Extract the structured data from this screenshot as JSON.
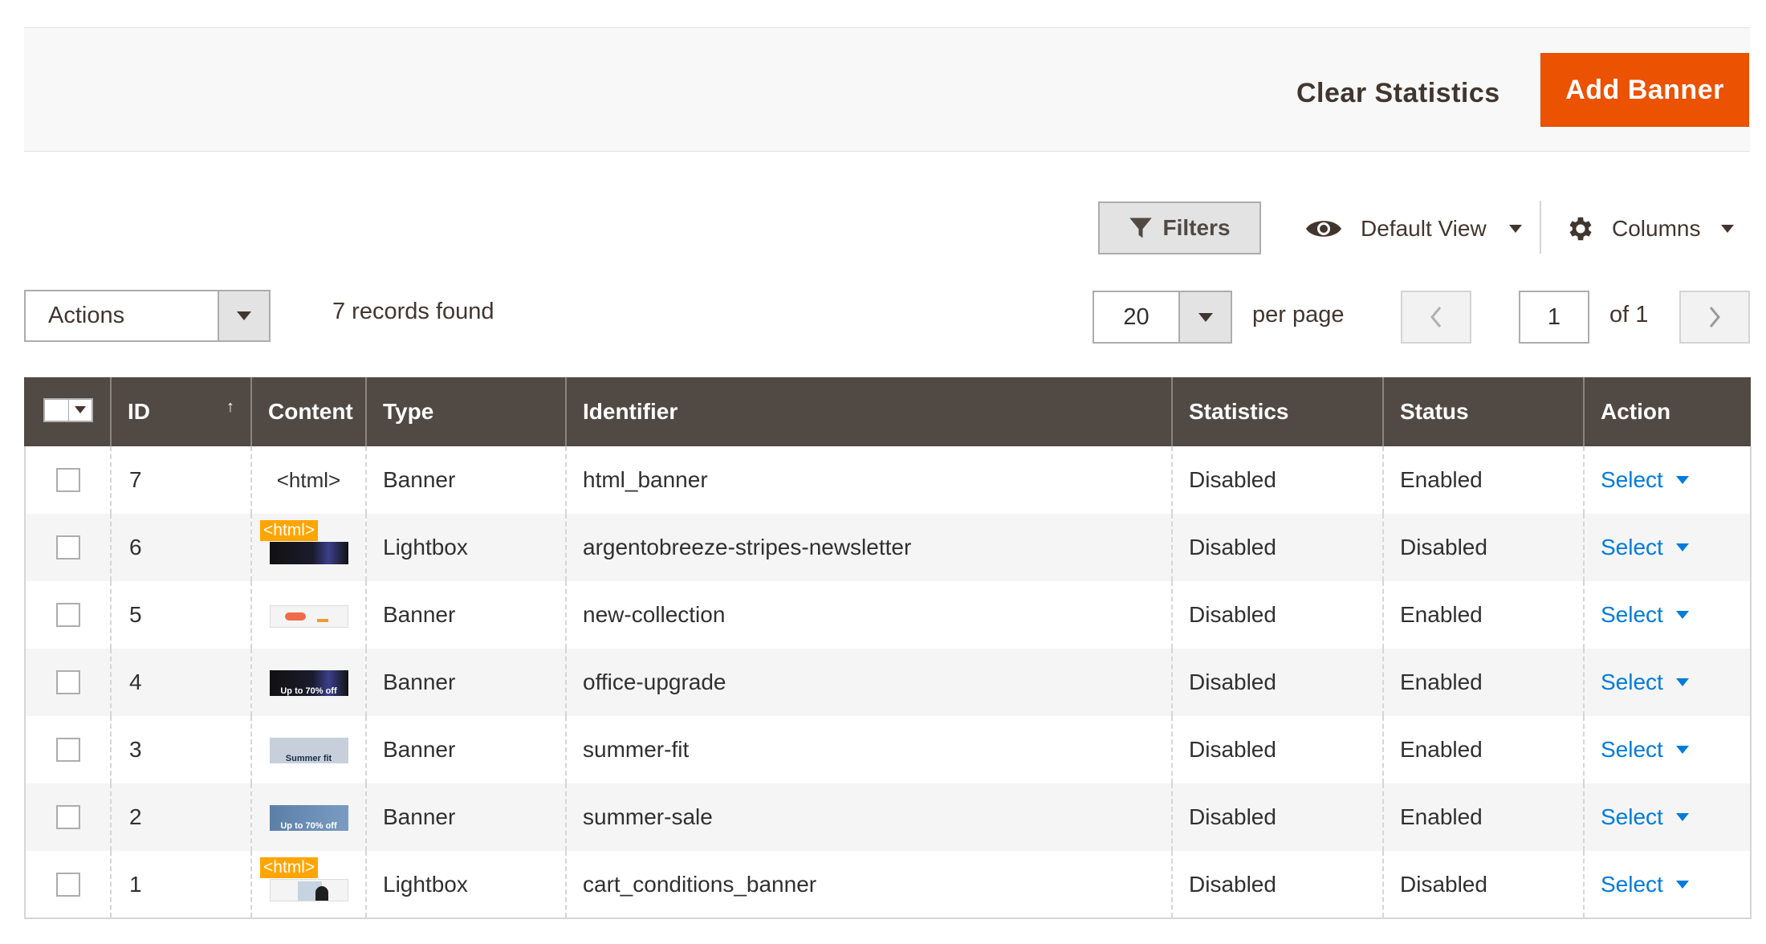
{
  "page_actions": {
    "clear_statistics": "Clear Statistics",
    "add_banner": "Add Banner"
  },
  "toolbar": {
    "filters": "Filters",
    "default_view": "Default View",
    "columns": "Columns",
    "actions": "Actions",
    "records_found": "7 records found",
    "per_page_value": "20",
    "per_page_label": "per page",
    "current_page": "1",
    "of_pages": "of 1"
  },
  "grid": {
    "headers": {
      "id": "ID",
      "content": "Content",
      "type": "Type",
      "identifier": "Identifier",
      "statistics": "Statistics",
      "status": "Status",
      "action": "Action"
    },
    "sort_indicator": "↑",
    "rows": [
      {
        "id": "7",
        "content": "<html>",
        "type": "Banner",
        "identifier": "html_banner",
        "statistics": "Disabled",
        "status": "Enabled",
        "action": "Select"
      },
      {
        "id": "6",
        "content_badge": "<html>",
        "type": "Lightbox",
        "identifier": "argentobreeze-stripes-newsletter",
        "statistics": "Disabled",
        "status": "Disabled",
        "action": "Select"
      },
      {
        "id": "5",
        "type": "Banner",
        "identifier": "new-collection",
        "statistics": "Disabled",
        "status": "Enabled",
        "action": "Select"
      },
      {
        "id": "4",
        "thumb_text": "Up to 70% off",
        "type": "Banner",
        "identifier": "office-upgrade",
        "statistics": "Disabled",
        "status": "Enabled",
        "action": "Select"
      },
      {
        "id": "3",
        "thumb_text": "Summer fit",
        "type": "Banner",
        "identifier": "summer-fit",
        "statistics": "Disabled",
        "status": "Enabled",
        "action": "Select"
      },
      {
        "id": "2",
        "thumb_text": "Up to 70% off",
        "type": "Banner",
        "identifier": "summer-sale",
        "statistics": "Disabled",
        "status": "Enabled",
        "action": "Select"
      },
      {
        "id": "1",
        "content_badge": "<html>",
        "type": "Lightbox",
        "identifier": "cart_conditions_banner",
        "statistics": "Disabled",
        "status": "Disabled",
        "action": "Select"
      }
    ]
  },
  "colors": {
    "accent": "#eb5202",
    "header_bg": "#514943",
    "link": "#007bdb",
    "html_badge": "#ffa500"
  },
  "icons": [
    "filter-icon",
    "eye-icon",
    "gear-icon",
    "chevron-left-icon",
    "chevron-right-icon",
    "caret-down-icon"
  ]
}
